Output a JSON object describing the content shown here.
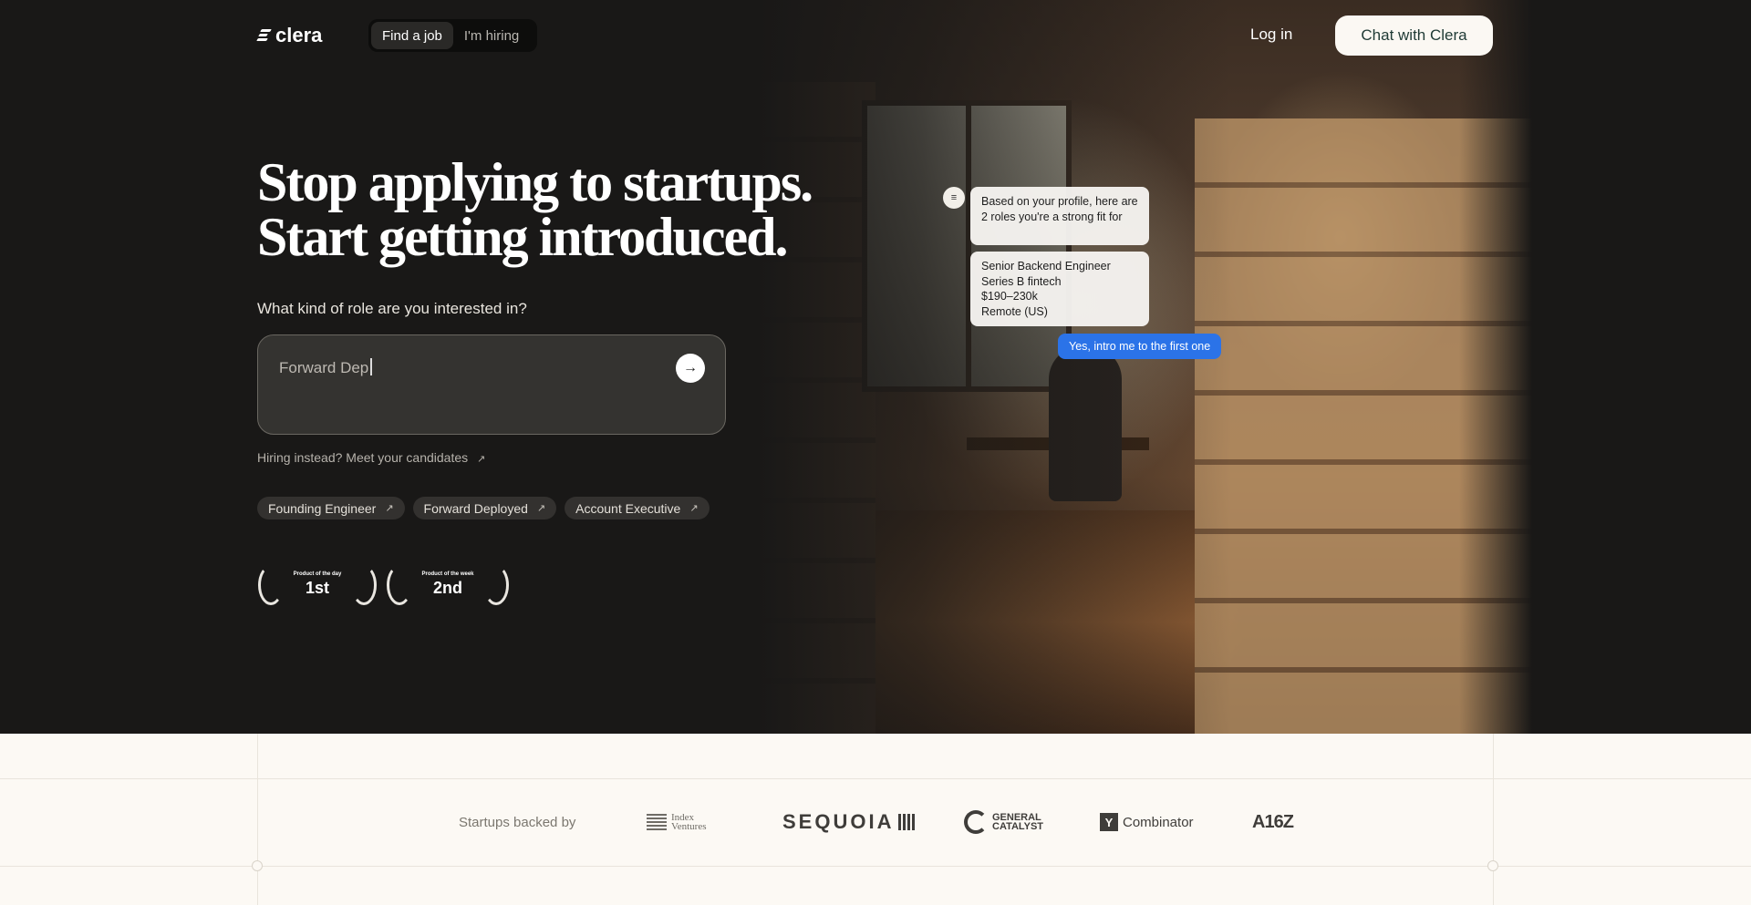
{
  "nav": {
    "logo_text": "clera",
    "toggle": [
      "Find a job",
      "I'm hiring"
    ],
    "login": "Log in",
    "cta": "Chat with Clera"
  },
  "hero": {
    "headline_line1": "Stop applying to startups.",
    "headline_line2": "Start getting introduced.",
    "question": "What kind of role are you interested in?",
    "search_value": "Forward Dep",
    "hiring_link": "Hiring instead? Meet your candidates",
    "pills": [
      "Founding Engineer",
      "Forward Deployed",
      "Account Executive"
    ],
    "awards": [
      {
        "label": "Product of the day",
        "rank": "1st"
      },
      {
        "label": "Product of the week",
        "rank": "2nd"
      }
    ]
  },
  "chat": {
    "message1": "Based on your profile, here are 2 roles you're a strong fit for",
    "role": {
      "title": "Senior Backend Engineer",
      "company": "Series B fintech",
      "salary": "$190–230k",
      "location": "Remote (US)"
    },
    "reply": "Yes, intro me to the first one"
  },
  "backers": {
    "label": "Startups backed by",
    "logos": [
      "Index Ventures",
      "SEQUOIA",
      "GENERAL CATALYST",
      "Combinator",
      "A16Z"
    ]
  },
  "colors": {
    "hero_bg": "#191817",
    "cta_bg": "#fbf8f3",
    "cta_text": "#1f3a35",
    "reply_bubble": "#2b73e8",
    "page_bg": "#fcf9f4"
  }
}
